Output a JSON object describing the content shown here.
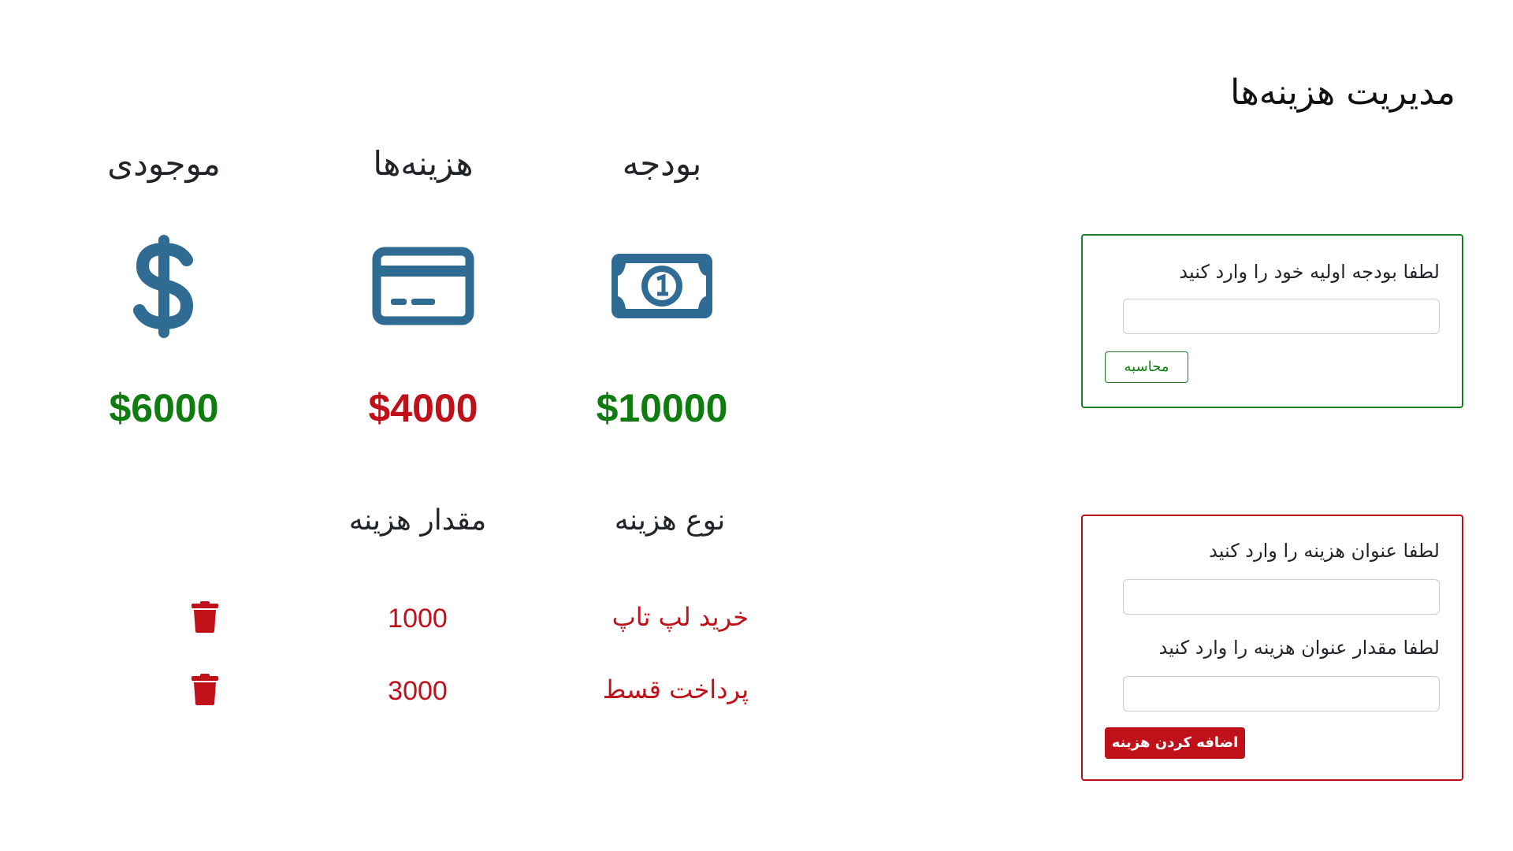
{
  "page": {
    "title": "مدیریت هزینه‌ها"
  },
  "colors": {
    "icon": "#2f6b93",
    "positive": "#0e7c0e",
    "negative": "#c0101a"
  },
  "summary": {
    "budget": {
      "heading": "بودجه",
      "icon": "money-bill-icon",
      "value": "$10000"
    },
    "expenses": {
      "heading": "هزینه‌ها",
      "icon": "credit-card-icon",
      "value": "$4000"
    },
    "balance": {
      "heading": "موجودی",
      "icon": "dollar-sign-icon",
      "value": "$6000"
    }
  },
  "expense_list": {
    "headers": {
      "type": "نوع هزینه",
      "amount": "مقدار هزینه"
    },
    "rows": [
      {
        "title": "خرید لپ تاپ",
        "amount": "1000",
        "delete_icon": "trash-icon"
      },
      {
        "title": "پرداخت قسط",
        "amount": "3000",
        "delete_icon": "trash-icon"
      }
    ]
  },
  "budget_form": {
    "label": "لطفا بودجه اولیه خود را وارد کنید",
    "input_value": "",
    "button": "محاسبه"
  },
  "expense_form": {
    "title_label": "لطفا عنوان هزینه را وارد کنید",
    "title_value": "",
    "amount_label": "لطفا مقدار عنوان هزینه را وارد کنید",
    "amount_value": "",
    "button": "اضافه کردن هزینه"
  }
}
